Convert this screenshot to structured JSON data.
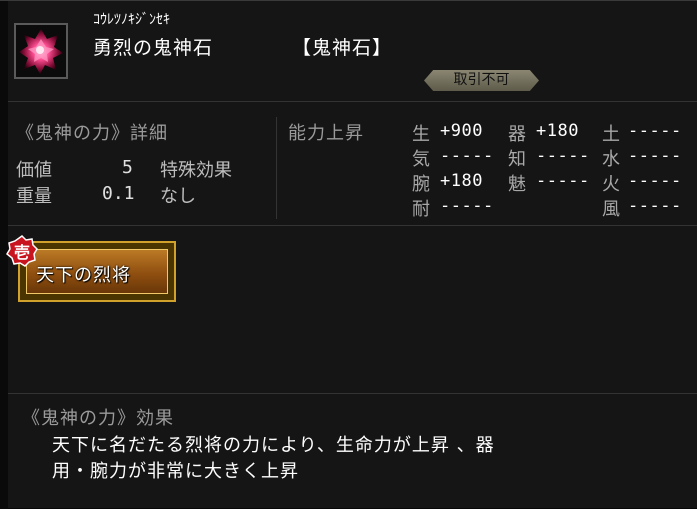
{
  "item": {
    "reading": "ｺｳﾚﾂﾉｷｼﾞﾝｾｷ",
    "name": "勇烈の鬼神石",
    "category": "【鬼神石】",
    "trade_status": "取引不可",
    "icon": "red-crystal-gem-icon"
  },
  "details": {
    "title": "《鬼神の力》詳細",
    "value_label": "価値",
    "value": "5",
    "weight_label": "重量",
    "weight": "0.1",
    "special_label": "特殊効果",
    "special_value": "なし"
  },
  "abilities": {
    "title": "能力上昇",
    "col1": [
      {
        "k": "生",
        "v": "+900"
      },
      {
        "k": "気",
        "v": "-----"
      },
      {
        "k": "腕",
        "v": "+180"
      },
      {
        "k": "耐",
        "v": "-----"
      }
    ],
    "col2": [
      {
        "k": "器",
        "v": "+180"
      },
      {
        "k": "知",
        "v": "-----"
      },
      {
        "k": "魅",
        "v": "-----"
      }
    ],
    "col3": [
      {
        "k": "土",
        "v": "-----"
      },
      {
        "k": "水",
        "v": "-----"
      },
      {
        "k": "火",
        "v": "-----"
      },
      {
        "k": "風",
        "v": "-----"
      }
    ]
  },
  "skill": {
    "rank": "壱",
    "label": "天下の烈将"
  },
  "effect": {
    "title": "《鬼神の力》効果",
    "line1": "天下に名だたる烈将の力により、生命力が上昇 、器",
    "line2": "用・腕力が非常に大きく上昇"
  }
}
